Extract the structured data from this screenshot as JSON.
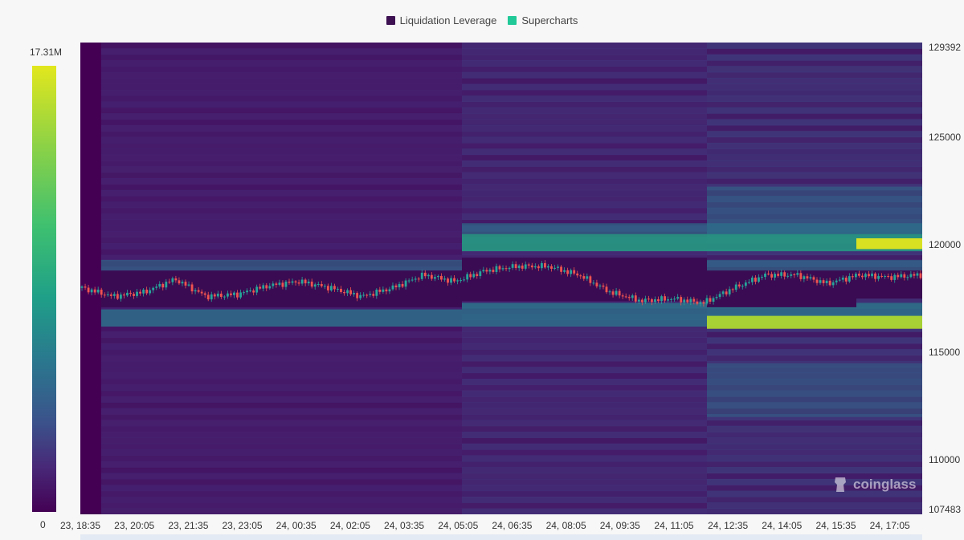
{
  "legend": [
    {
      "label": "Liquidation Leverage",
      "color": "#3d1152"
    },
    {
      "label": "Supercharts",
      "color": "#20c997"
    }
  ],
  "colorbar": {
    "max_label": "17.31M",
    "min_label": "0"
  },
  "watermark": "coinglass",
  "colors": {
    "background": "#44115f",
    "candle_up": "#26a69a",
    "candle_down": "#ef5350"
  },
  "chart_data": {
    "type": "heatmap",
    "x_ticks": [
      "23, 18:35",
      "23, 20:05",
      "23, 21:35",
      "23, 23:05",
      "24, 00:35",
      "24, 02:05",
      "24, 03:35",
      "24, 05:05",
      "24, 06:35",
      "24, 08:05",
      "24, 09:35",
      "24, 11:05",
      "24, 12:35",
      "24, 14:05",
      "24, 15:35",
      "24, 17:05"
    ],
    "y_ticks": [
      "129392",
      "125000",
      "120000",
      "115000",
      "110000",
      "107483"
    ],
    "ylim": [
      107483,
      129392
    ],
    "color_range": [
      0,
      17310000
    ],
    "color_scale": "viridis",
    "price_series": {
      "name": "Price",
      "approx_close": [
        118000,
        117600,
        117800,
        118400,
        117600,
        117700,
        118100,
        118300,
        118000,
        117600,
        118000,
        118600,
        118300,
        118800,
        119000,
        119000,
        118600,
        117800,
        117400,
        117500,
        117300,
        118000,
        118600,
        118600,
        118200,
        118600,
        118500,
        118600
      ]
    },
    "liquidation_levels": [
      {
        "price": 120000,
        "intensity": "high",
        "from": "24, 05:05"
      },
      {
        "price": 116300,
        "intensity": "very high",
        "from": "24, 12:35"
      },
      {
        "price": 116900,
        "intensity": "medium",
        "from": "23, 18:35"
      },
      {
        "price": 118900,
        "intensity": "medium",
        "from": "23, 18:35"
      }
    ]
  }
}
